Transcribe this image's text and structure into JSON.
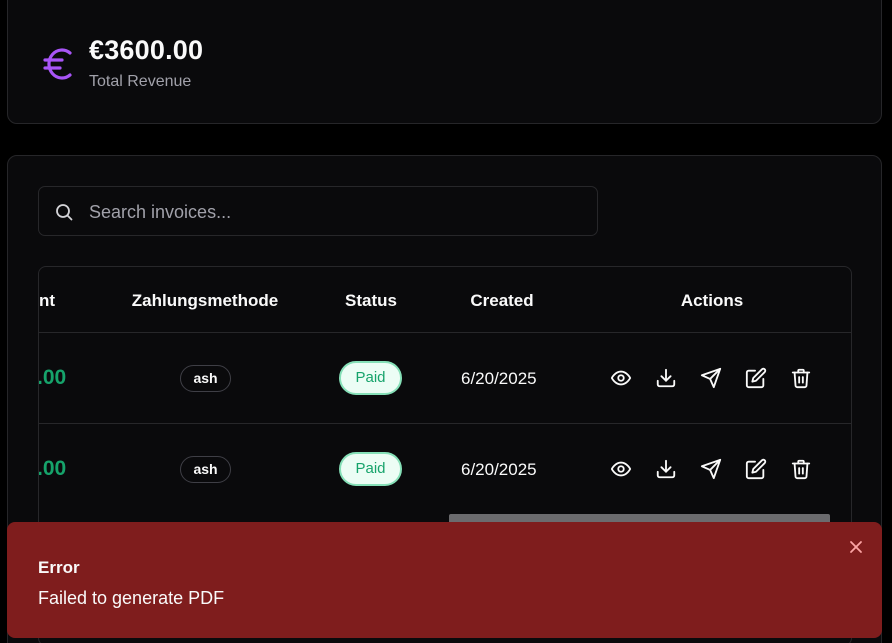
{
  "revenue": {
    "amount": "€3600.00",
    "label": "Total Revenue",
    "icon": "euro-icon",
    "accent": "#a855f7"
  },
  "search": {
    "placeholder": "Search invoices...",
    "value": ""
  },
  "table": {
    "headers": {
      "amount": "nt",
      "method": "Zahlungsmethode",
      "status": "Status",
      "created": "Created",
      "actions": "Actions"
    },
    "rows": [
      {
        "amount": ".00",
        "method": "ash",
        "status": "Paid",
        "created": "6/20/2025"
      },
      {
        "amount": ".00",
        "method": "ash",
        "status": "Paid",
        "created": "6/20/2025"
      }
    ],
    "action_icons": [
      "eye-icon",
      "download-icon",
      "send-icon",
      "edit-icon",
      "trash-icon"
    ]
  },
  "toast": {
    "title": "Error",
    "message": "Failed to generate PDF",
    "color": "#7f1d1d"
  },
  "colors": {
    "paid_text": "#16a36b",
    "paid_bg": "#ecfdf5",
    "amount_green": "#16a36b"
  }
}
